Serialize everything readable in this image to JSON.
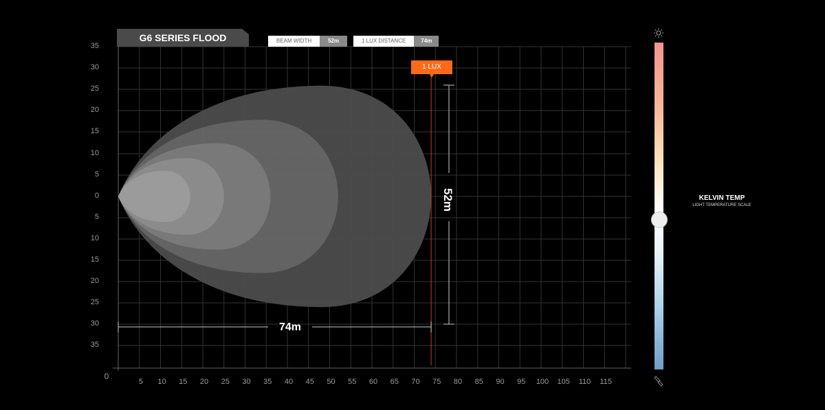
{
  "header": {
    "title": "G6 SERIES FLOOD",
    "beam_width_label": "BEAM WIDTH",
    "beam_width_value": "52m",
    "lux_distance_label": "1 LUX DISTANCE",
    "lux_distance_value": "74m"
  },
  "chart_data": {
    "type": "area",
    "x_ticks": [
      "5",
      "10",
      "15",
      "20",
      "25",
      "30",
      "35",
      "40",
      "45",
      "50",
      "55",
      "60",
      "65",
      "70",
      "75",
      "80",
      "85",
      "90",
      "95",
      "100",
      "105",
      "110",
      "115"
    ],
    "x_origin_label": "0",
    "y_ticks": [
      "35",
      "30",
      "25",
      "20",
      "15",
      "10",
      "5",
      "0",
      "5",
      "10",
      "15",
      "20",
      "25",
      "30",
      "35"
    ],
    "xlim": [
      0,
      120
    ],
    "ylim": [
      -35,
      35
    ],
    "grid": true,
    "lux_marker": {
      "label": "1 LUX",
      "x": 74
    },
    "beam_width_annotation": "52m",
    "distance_annotation": "74m",
    "contours": [
      {
        "reach": 74,
        "half_width": 26
      },
      {
        "reach": 52,
        "half_width": 18
      },
      {
        "reach": 36,
        "half_width": 12.5
      },
      {
        "reach": 25,
        "half_width": 9
      },
      {
        "reach": 17,
        "half_width": 6
      }
    ]
  },
  "kelvin": {
    "title": "KELVIN TEMP",
    "subtitle": "LIGHT TEMPERATURE SCALE",
    "value": 0.54,
    "colors": [
      "#f4958f",
      "#fde0b5",
      "#ffffff",
      "#a9cfe8",
      "#6f9fc5"
    ]
  },
  "icons": {
    "top": "sun-icon",
    "bottom": "flashlight-icon"
  }
}
